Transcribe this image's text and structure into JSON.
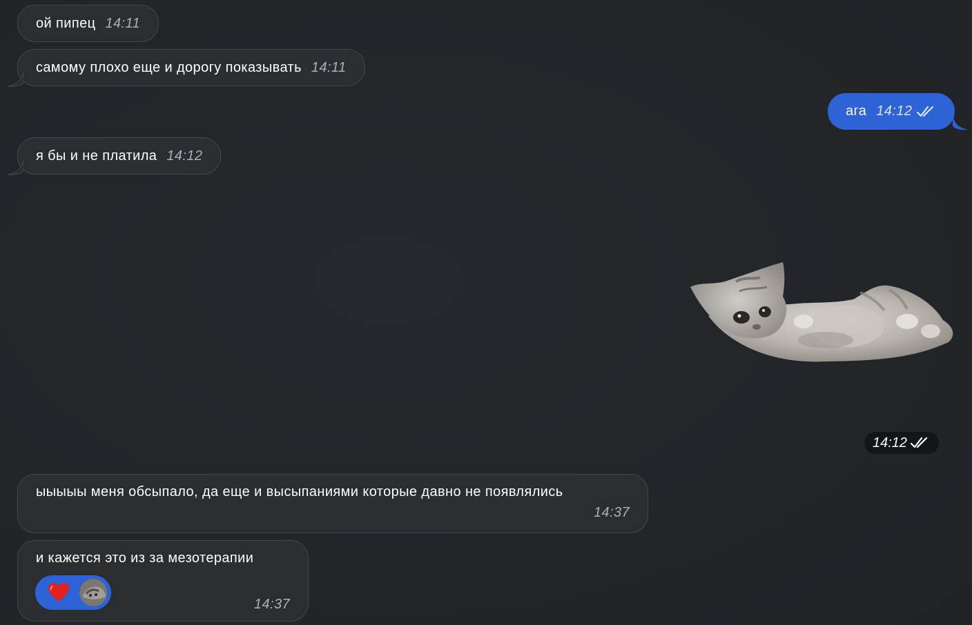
{
  "messages": {
    "m1": {
      "text": "ой пипец",
      "time": "14:11"
    },
    "m2": {
      "text": "самому плохо еще и дорогу показывать",
      "time": "14:11"
    },
    "m3": {
      "text": "ага",
      "time": "14:12"
    },
    "m4": {
      "text": "я бы и не платила",
      "time": "14:12"
    },
    "sticker": {
      "name": "kitten-sticker",
      "time": "14:12"
    },
    "m5": {
      "text": "ыыыыы меня обсыпало, да еще и высыпаниями которые давно не появлялись",
      "time": "14:37"
    },
    "m6": {
      "text": "и кажется это из за мезотерапии",
      "time": "14:37",
      "reaction": "heart-icon"
    }
  },
  "colors": {
    "background": "#23272b",
    "incoming_bubble": "#2b2e31",
    "outgoing_bubble": "#2d63d6",
    "reaction_bg": "#2d63d6"
  }
}
